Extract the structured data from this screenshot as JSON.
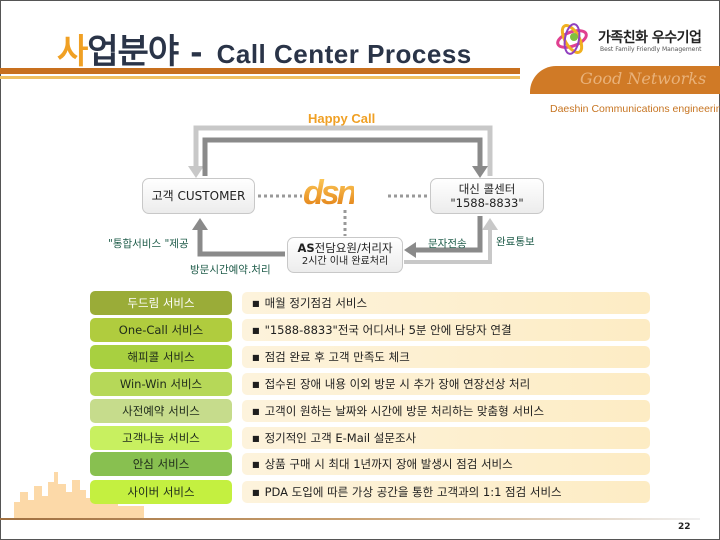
{
  "header": {
    "title_ko_accent": "사",
    "title_ko_rest": "업분야",
    "title_dash": "-",
    "title_en": "Call Center Process"
  },
  "branding": {
    "family_title": "가족친화 우수기업",
    "family_subtitle": "Best Family Friendly Management",
    "good_network": "Good Networks",
    "company": "Daeshin Communications engineering",
    "accent_color": "#f0a024",
    "brand_orange": "#d07a26"
  },
  "diagram": {
    "happy_call": "Happy Call",
    "logo_text": "dsn",
    "customer_node": "고객 CUSTOMER",
    "center_node_line1": "대신 콜센터",
    "center_node_line2": "\"1588-8833\"",
    "as_node_bold": "AS",
    "as_node_line1": "전담요원/처리자",
    "as_node_line2": "2시간 이내 완료처리",
    "label_integrated": "\"통합서비스 \"제공",
    "label_visit": "방문시간예약.처리",
    "label_sms": "문자전송",
    "label_done": "완료통보"
  },
  "services": [
    {
      "name": "두드림 서비스",
      "desc": "매월 정기점검 서비스",
      "color": "#9aac38",
      "text_color": "#ffffff"
    },
    {
      "name": "One-Call 서비스",
      "desc": "\"1588-8833\"전국 어디서나 5분 안에 담당자 연결",
      "color": "#b0cc3e",
      "text_color": "#1e2a1a"
    },
    {
      "name": "해피콜 서비스",
      "desc": "점검 완료 후 고객 만족도 체크",
      "color": "#a8d040",
      "text_color": "#1e2a1a"
    },
    {
      "name": "Win-Win 서비스",
      "desc": "접수된 장애 내용 이외 방문 시 추가 장애 연장선상 처리",
      "color": "#b6d858",
      "text_color": "#1e2a1a"
    },
    {
      "name": "사전예약 서비스",
      "desc": "고객이 원하는 날짜와 시간에 방문 처리하는 맞춤형 서비스",
      "color": "#c6dc8c",
      "text_color": "#1e2a1a"
    },
    {
      "name": "고객나눔 서비스",
      "desc": "정기적인 고객 E-Mail 설문조사",
      "color": "#c8f060",
      "text_color": "#1e2a1a"
    },
    {
      "name": "안심 서비스",
      "desc": "상품 구매 시 최대 1년까지 장애 발생시 점검 서비스",
      "color": "#88c050",
      "text_color": "#1e2a1a"
    },
    {
      "name": "사이버 서비스",
      "desc": "PDA 도입에 따른 가상 공간을 통한 고객과의 1:1 점검 서비스",
      "color": "#c4f040",
      "text_color": "#1e2a1a"
    }
  ],
  "footer": {
    "page_number": "22"
  }
}
